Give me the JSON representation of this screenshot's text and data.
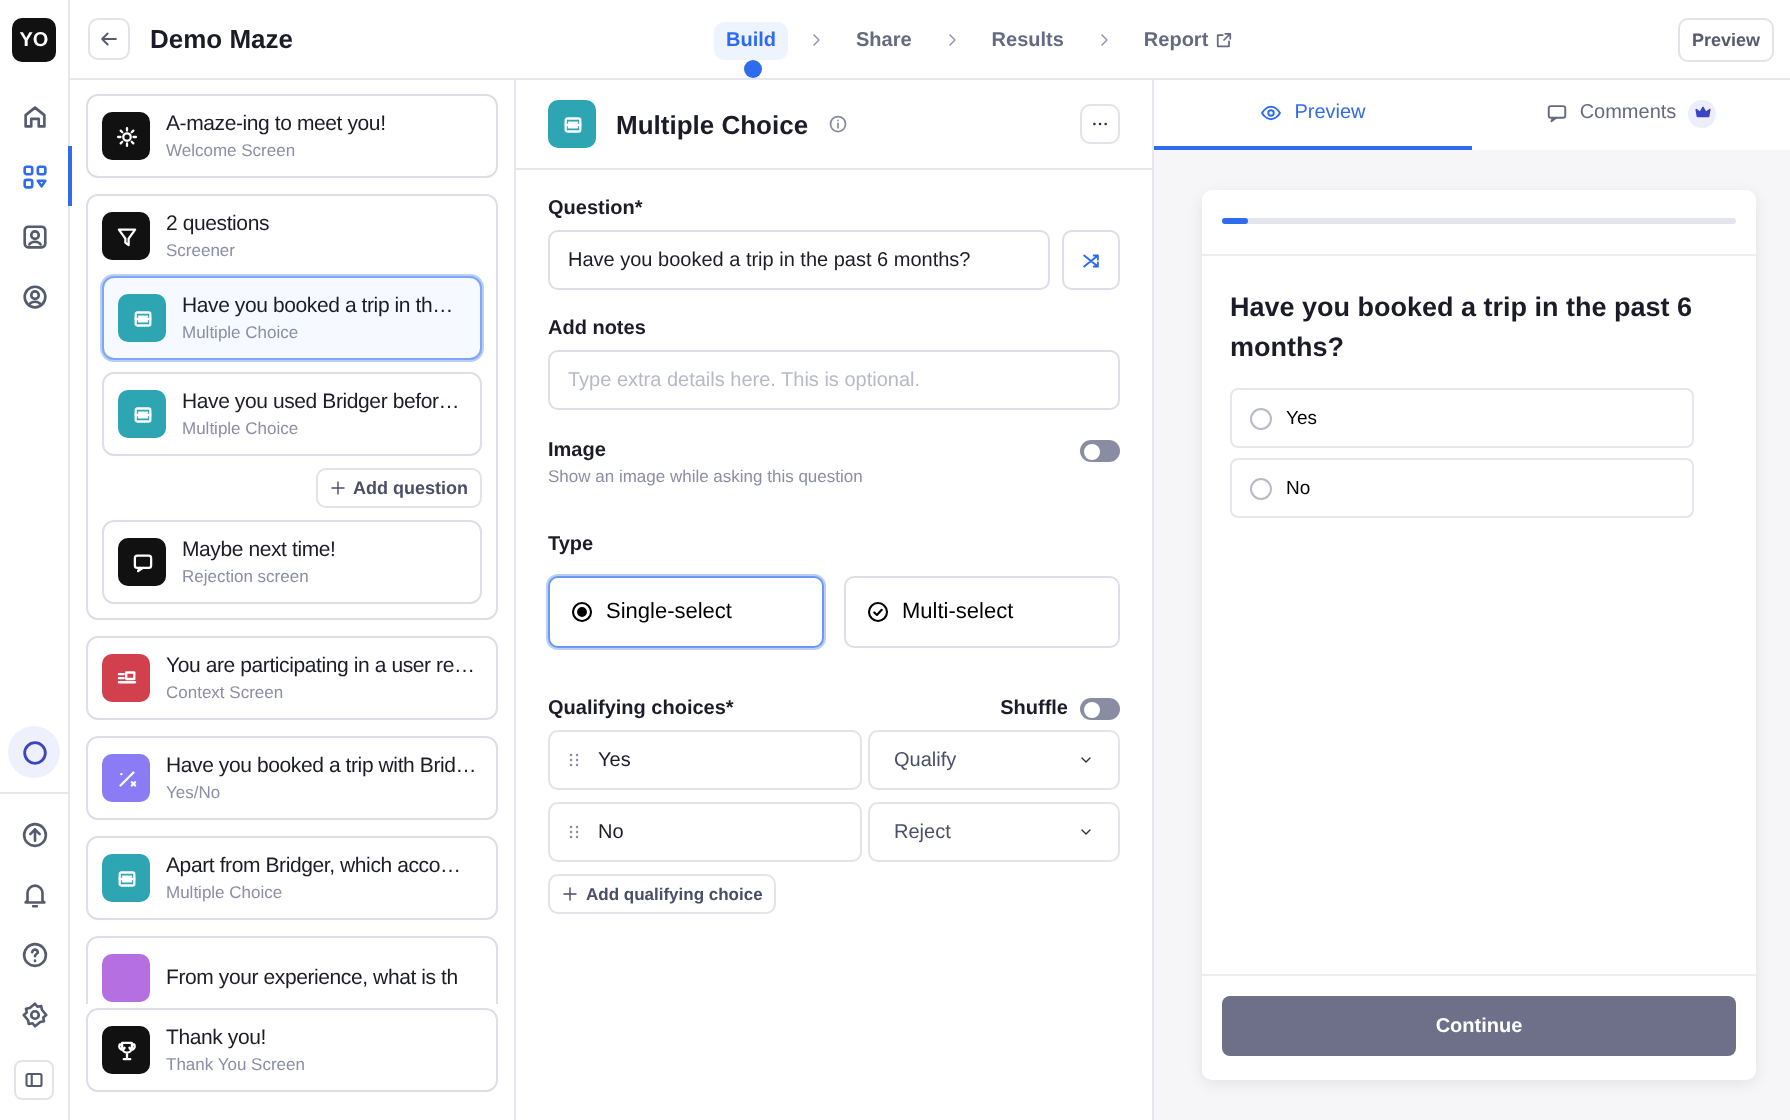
{
  "rail": {
    "logo": "YO",
    "top_items": [
      {
        "kind": "home",
        "selected": false
      },
      {
        "kind": "grid",
        "selected": true
      },
      {
        "kind": "contacts",
        "selected": false
      },
      {
        "kind": "person",
        "selected": false
      }
    ],
    "bottom_items": [
      {
        "kind": "ring",
        "selected": true
      },
      {
        "kind": "upload",
        "selected": false
      },
      {
        "kind": "bell",
        "selected": false
      },
      {
        "kind": "help",
        "selected": false
      },
      {
        "kind": "gear",
        "selected": false
      },
      {
        "kind": "panel",
        "selected": false
      }
    ]
  },
  "header": {
    "title": "Demo Maze",
    "steps": [
      {
        "label": "Build",
        "selected": true,
        "external": false
      },
      {
        "label": "Share",
        "selected": false,
        "external": false
      },
      {
        "label": "Results",
        "selected": false,
        "external": false
      },
      {
        "label": "Report",
        "selected": false,
        "external": true
      }
    ],
    "preview_button": "Preview"
  },
  "blocks": [
    {
      "kind": "welcome",
      "title": "A-maze-ing to meet you!",
      "subtitle": "Welcome Screen"
    },
    {
      "kind": "screener",
      "title": "2 questions",
      "subtitle": "Screener",
      "add_button": "Add question",
      "children": [
        {
          "kind": "multiple",
          "title": "Have you booked a trip in th…",
          "subtitle": "Multiple Choice",
          "selected": true
        },
        {
          "kind": "multiple",
          "title": "Have you used Bridger befor…",
          "subtitle": "Multiple Choice",
          "selected": false
        }
      ],
      "rejection": {
        "kind": "rejection",
        "title": "Maybe next time!",
        "subtitle": "Rejection screen"
      }
    },
    {
      "kind": "context",
      "title": "You are participating in a user re…",
      "subtitle": "Context Screen"
    },
    {
      "kind": "yesno",
      "title": "Have you booked a trip with Brid…",
      "subtitle": "Yes/No"
    },
    {
      "kind": "multiple",
      "title": "Apart from Bridger, which acco…",
      "subtitle": "Multiple Choice"
    },
    {
      "kind": "opinion",
      "title": "From your experience, what is th"
    }
  ],
  "end_block": {
    "kind": "thanks",
    "title": "Thank you!",
    "subtitle": "Thank You Screen"
  },
  "editor": {
    "title": "Multiple Choice",
    "question_label": "Question*",
    "question_value": "Have you booked a trip in the past 6 months?",
    "notes_label": "Add notes",
    "notes_placeholder": "Type extra details here. This is optional.",
    "image_label": "Image",
    "image_hint": "Show an image while asking this question",
    "image_on": false,
    "type_label": "Type",
    "type_options": [
      {
        "kind": "radio",
        "label": "Single-select",
        "selected": true
      },
      {
        "kind": "check",
        "label": "Multi-select",
        "selected": false
      }
    ],
    "choices_label": "Qualifying choices*",
    "shuffle_label": "Shuffle",
    "shuffle_on": false,
    "choices": [
      {
        "label": "Yes",
        "outcome": "Qualify"
      },
      {
        "label": "No",
        "outcome": "Reject"
      }
    ],
    "add_choice": "Add qualifying choice"
  },
  "preview": {
    "tabs": [
      {
        "kind": "preview",
        "label": "Preview",
        "selected": true
      },
      {
        "kind": "comments",
        "label": "Comments",
        "selected": false
      }
    ],
    "progress": {
      "level": 0.05
    },
    "question": "Have you booked a trip in the past 6 months?",
    "options": [
      {
        "label": "Yes",
        "selected": false
      },
      {
        "label": "No",
        "selected": false
      }
    ],
    "continue_button": "Continue"
  }
}
